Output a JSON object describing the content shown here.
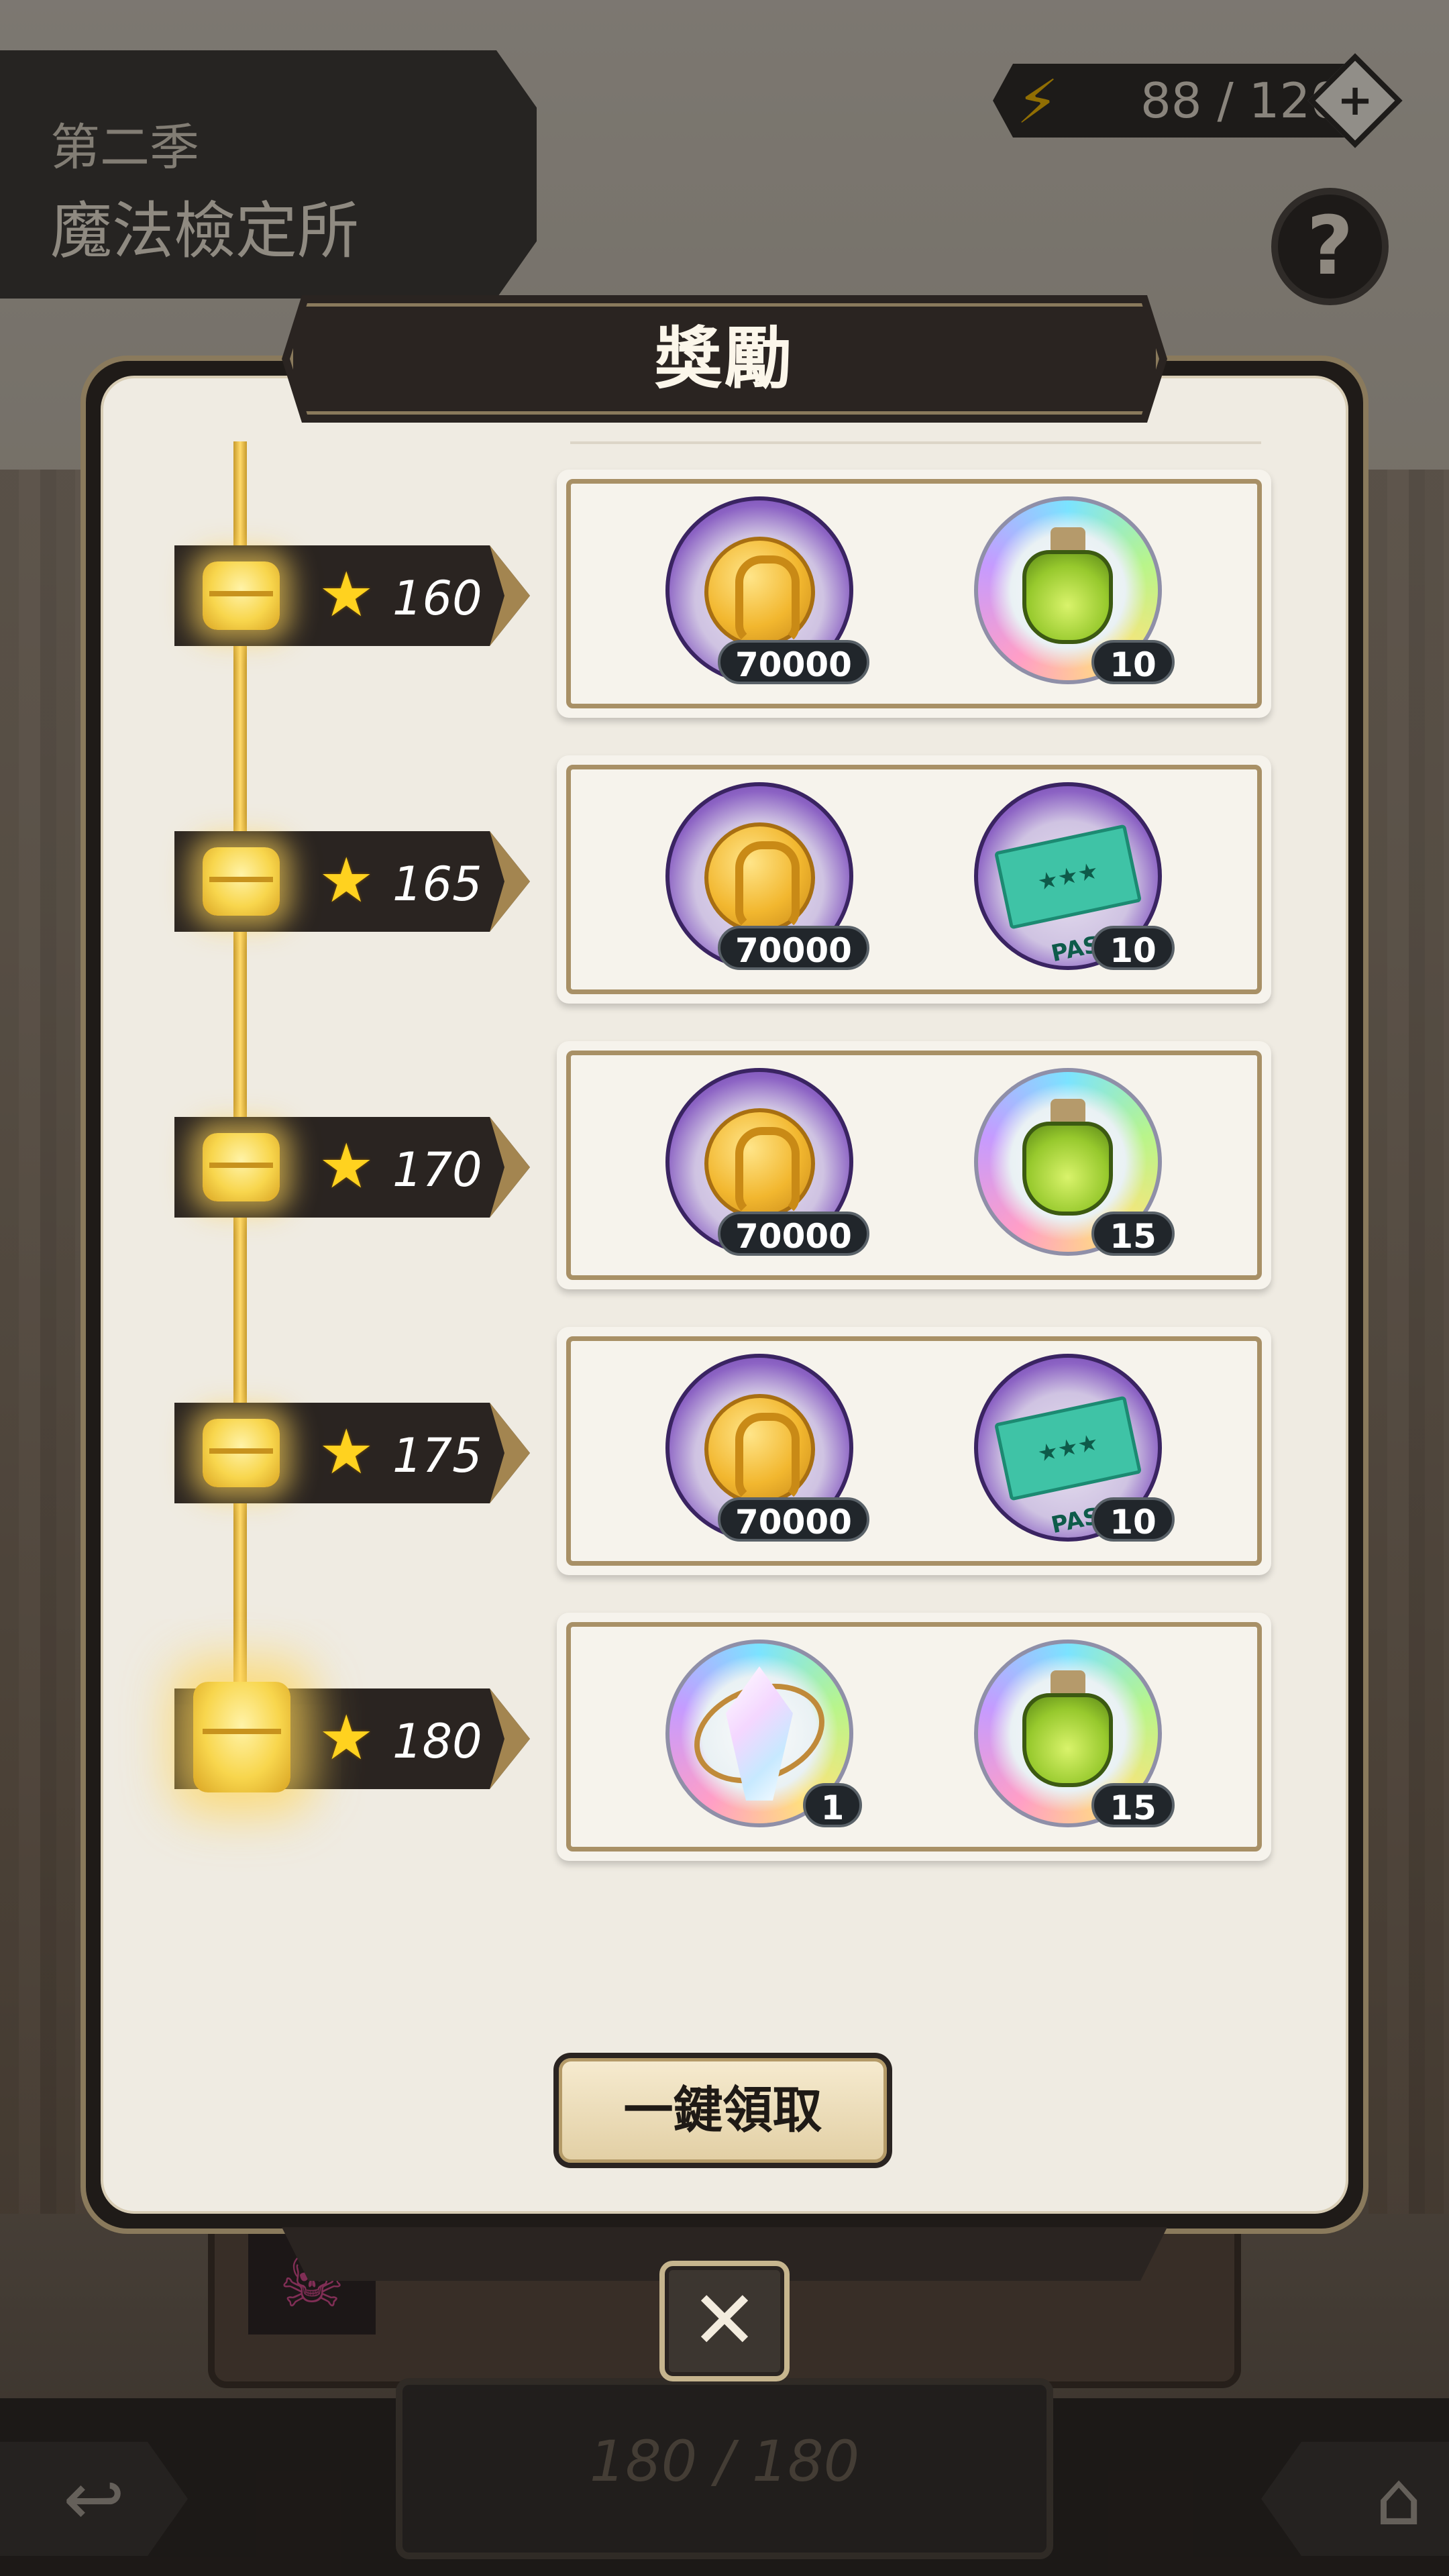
{
  "header": {
    "season_label": "第二季",
    "event_title": "魔法檢定所",
    "energy": "88 / 120",
    "energy_add_icon": "plus-icon",
    "help_icon": "question-icon"
  },
  "dialog": {
    "title": "獎勵",
    "claim_all_label": "一鍵領取",
    "close_icon": "close-icon"
  },
  "milestones": [
    {
      "stars": "160",
      "rewards": [
        {
          "icon": "gold-coin-icon",
          "count": "70000"
        },
        {
          "icon": "green-potion-icon",
          "count": "10"
        }
      ]
    },
    {
      "stars": "165",
      "rewards": [
        {
          "icon": "gold-coin-icon",
          "count": "70000"
        },
        {
          "icon": "pass-ticket-icon",
          "count": "10"
        }
      ]
    },
    {
      "stars": "170",
      "rewards": [
        {
          "icon": "gold-coin-icon",
          "count": "70000"
        },
        {
          "icon": "green-potion-icon",
          "count": "15"
        }
      ]
    },
    {
      "stars": "175",
      "rewards": [
        {
          "icon": "gold-coin-icon",
          "count": "70000"
        },
        {
          "icon": "pass-ticket-icon",
          "count": "10"
        }
      ]
    },
    {
      "stars": "180",
      "rewards": [
        {
          "icon": "crystal-icon",
          "count": "1"
        },
        {
          "icon": "green-potion-icon",
          "count": "15"
        }
      ]
    }
  ],
  "footer": {
    "progress": "180 / 180",
    "back_icon": "back-arrow-icon",
    "home_icon": "home-icon"
  },
  "colors": {
    "track_gold": "#ffd96a",
    "banner_dark": "#2a2421",
    "panel_cream": "#efebe2",
    "badge_dark": "#21262b",
    "star_yellow": "#ffd21f"
  }
}
